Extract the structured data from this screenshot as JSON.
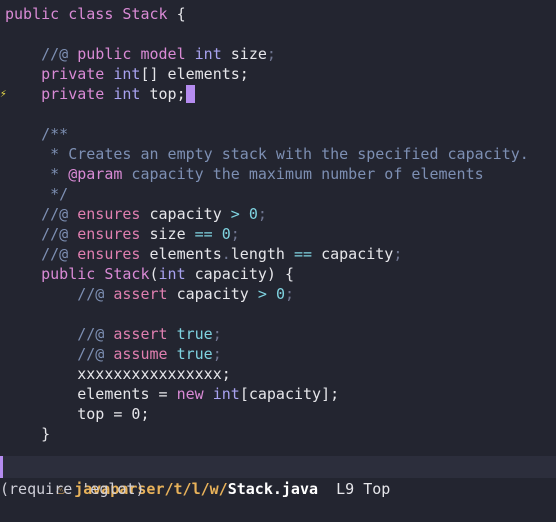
{
  "editor": {
    "l1_kw": "public",
    "l1_kw2": "class",
    "l1_name": "Stack",
    "l1_brace": " {",
    "l3_cm": "//@",
    "l3_kw1": "public",
    "l3_kw2": "model",
    "l3_ty": "int",
    "l3_rest": "size",
    "l3_semi": ";",
    "l4_kw": "private",
    "l4_ty": "int",
    "l4_rest": "[] elements;",
    "l5_kw": "private",
    "l5_ty": "int",
    "l5_rest": "top;",
    "l7": "/**",
    "l8": " * Creates an empty stack with the specified capacity.",
    "l9_a": " * ",
    "l9_tag": "@param",
    "l9_b": " capacity the maximum number of elements",
    "l10": " */",
    "l11_cm": "//@",
    "l11_kw": "ensures",
    "l11_a": "capacity",
    "l11_op": ">",
    "l11_num": "0",
    "l11_semi": ";",
    "l12_cm": "//@",
    "l12_kw": "ensures",
    "l12_a": "size",
    "l12_op": "==",
    "l12_num": "0",
    "l12_semi": ";",
    "l13_cm": "//@",
    "l13_kw": "ensures",
    "l13_a": "elements",
    "l13_dot": ".",
    "l13_b": "length",
    "l13_op": "==",
    "l13_c": "capacity",
    "l13_semi": ";",
    "l14_kw": "public",
    "l14_name": "Stack",
    "l14_p1": "(",
    "l14_ty": "int",
    "l14_rest": " capacity) {",
    "l15_cm": "//@",
    "l15_kw": "assert",
    "l15_a": "capacity",
    "l15_op": ">",
    "l15_num": "0",
    "l15_semi": ";",
    "l17_cm": "//@",
    "l17_kw": "assert",
    "l17_val": "true",
    "l17_semi": ";",
    "l18_cm": "//@",
    "l18_kw": "assume",
    "l18_val": "true",
    "l18_semi": ";",
    "l19": "xxxxxxxxxxxxxxxx;",
    "l20_a": "elements = ",
    "l20_kw": "new",
    "l20_ty": "int",
    "l20_b": "[capacity];",
    "l21": "top = 0;",
    "l22": "}",
    "fringe_marker": "⚡"
  },
  "modeline": {
    "icon": "java-icon",
    "project": "javaparser",
    "path": "/t/l/w/",
    "file": "Stack.java",
    "line": "L9",
    "position": "Top"
  },
  "minibuffer": {
    "text": "(require 'eglot)"
  },
  "colors": {
    "background": "#232530",
    "keyword": "#d98ad5",
    "type": "#a8a2f0",
    "comment": "#7d8fb3",
    "jml_keyword": "#e07fb0",
    "number": "#7fd3e0",
    "cursor": "#b58cf0",
    "modeline_path": "#e8b25a"
  }
}
